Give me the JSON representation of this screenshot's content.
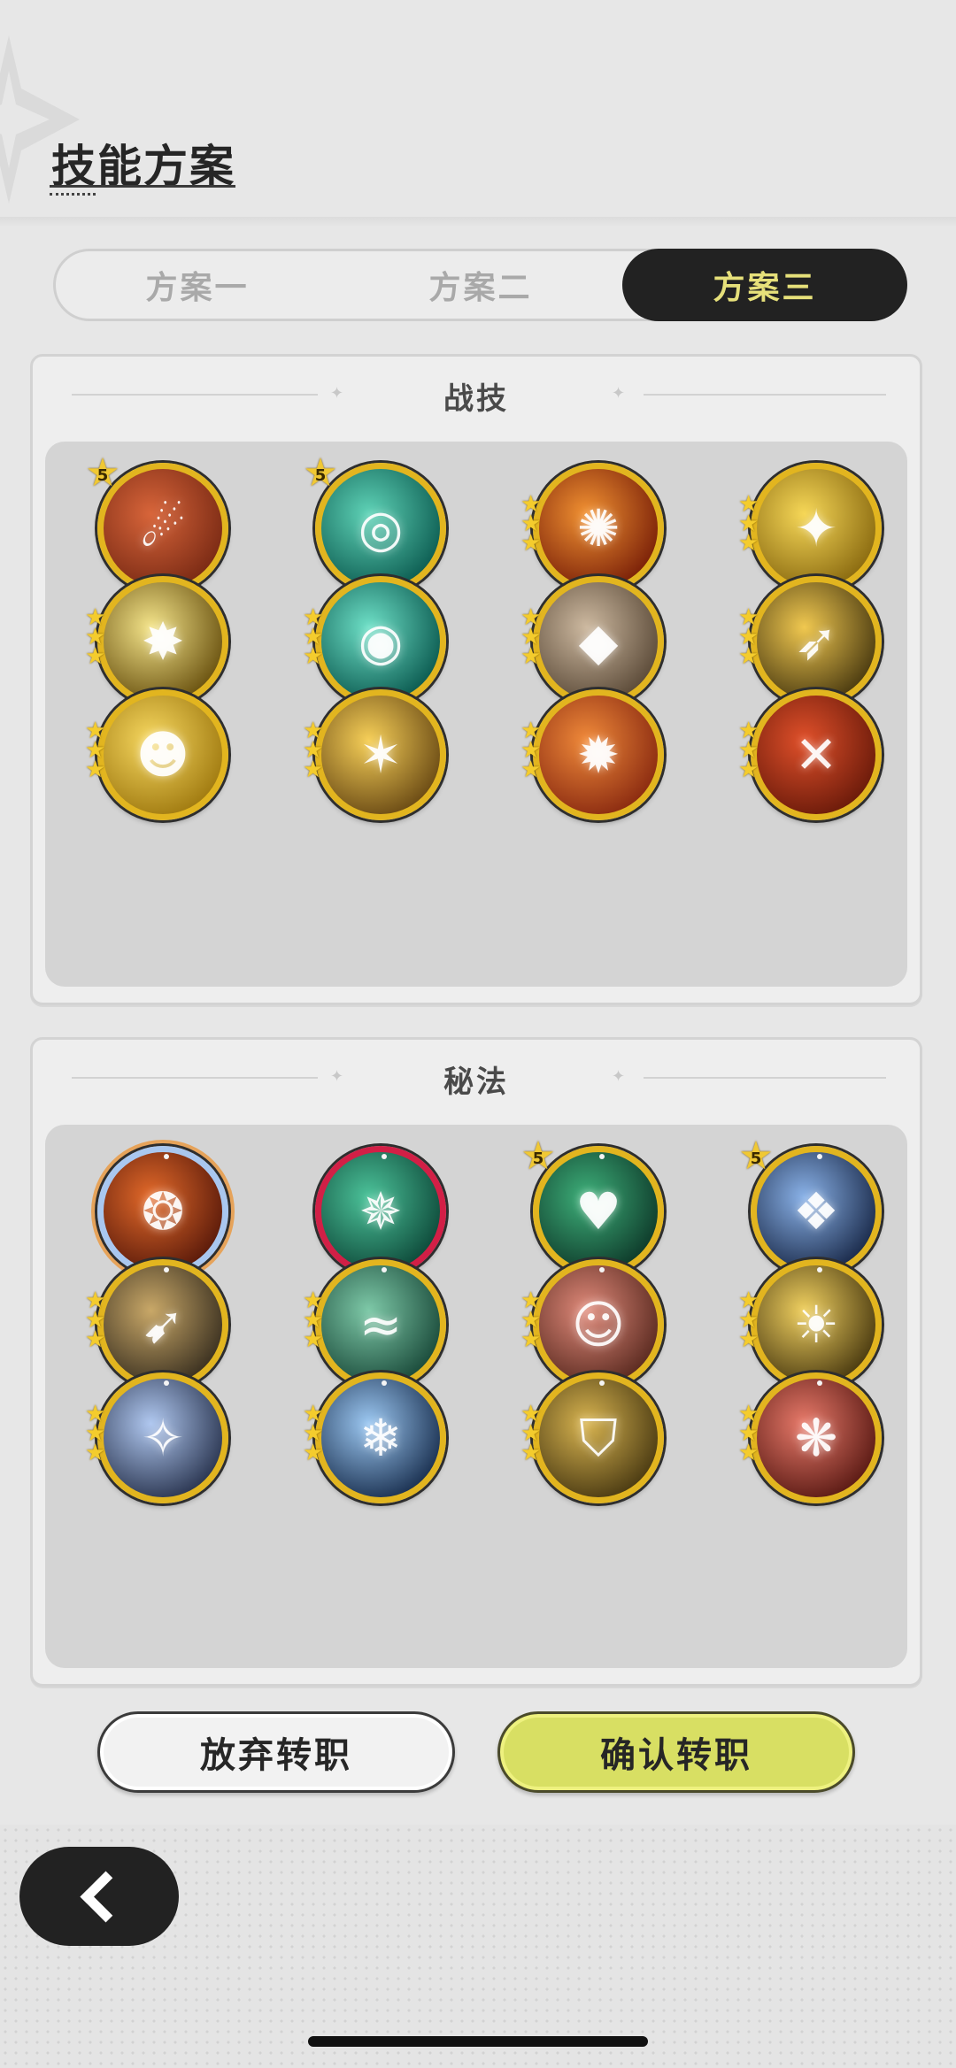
{
  "header": {
    "title": "技能方案"
  },
  "tabs": [
    {
      "label": "方案一",
      "active": false
    },
    {
      "label": "方案二",
      "active": false
    },
    {
      "label": "方案三",
      "active": true
    }
  ],
  "sections": [
    {
      "title": "战技",
      "icons": [
        {
          "name": "meteor-skill-icon",
          "badge": "5",
          "colors": [
            "#7a2a14",
            "#d8653a"
          ],
          "glyph": "☄"
        },
        {
          "name": "wind-slash-skill-icon",
          "badge": "5",
          "colors": [
            "#0d5d52",
            "#5fd3b7"
          ],
          "glyph": "◎"
        },
        {
          "name": "flame-burst-skill-icon",
          "stars": 3,
          "colors": [
            "#7a2008",
            "#f29232"
          ],
          "glyph": "✺"
        },
        {
          "name": "star-strike-skill-icon",
          "stars": 3,
          "colors": [
            "#8a6a10",
            "#f6d757"
          ],
          "glyph": "✦"
        },
        {
          "name": "lightning-orb-skill-icon",
          "stars": 3,
          "colors": [
            "#6a5210",
            "#f4e48a"
          ],
          "glyph": "✸"
        },
        {
          "name": "whirlwind-skill-icon",
          "stars": 3,
          "colors": [
            "#0b5a50",
            "#6ee0c7"
          ],
          "glyph": "◉"
        },
        {
          "name": "rock-shield-skill-icon",
          "stars": 3,
          "colors": [
            "#5b4a38",
            "#cdb9a0"
          ],
          "glyph": "◆"
        },
        {
          "name": "light-dash-skill-icon",
          "stars": 3,
          "colors": [
            "#4a3a10",
            "#f0c850"
          ],
          "glyph": "➶"
        },
        {
          "name": "guardian-figure-skill-icon",
          "stars": 3,
          "colors": [
            "#a07a10",
            "#f7d860"
          ],
          "glyph": "☻"
        },
        {
          "name": "shatter-skill-icon",
          "stars": 3,
          "colors": [
            "#6a4a14",
            "#f6cf58"
          ],
          "glyph": "✶"
        },
        {
          "name": "fire-spiral-skill-icon",
          "stars": 3,
          "colors": [
            "#8a2a10",
            "#f08a3a"
          ],
          "glyph": "✹"
        },
        {
          "name": "thorn-blast-skill-icon",
          "stars": 3,
          "colors": [
            "#6a1a0a",
            "#e0502a"
          ],
          "glyph": "✕"
        }
      ]
    },
    {
      "title": "秘法",
      "icons": [
        {
          "name": "fire-core-secret-icon",
          "frame": "rainbow",
          "colors": [
            "#5a1a0a",
            "#e46a2a"
          ],
          "glyph": "❂"
        },
        {
          "name": "emerald-spikes-secret-icon",
          "frame": "red",
          "colors": [
            "#0e4a3a",
            "#4cc39a"
          ],
          "glyph": "✵"
        },
        {
          "name": "heart-heal-secret-icon",
          "badge": "5",
          "colors": [
            "#0e3a2a",
            "#3eb07a"
          ],
          "glyph": "♥"
        },
        {
          "name": "crystal-shard-secret-icon",
          "badge": "5",
          "colors": [
            "#1a2a4a",
            "#8ab2e8"
          ],
          "glyph": "❖"
        },
        {
          "name": "wing-hand-secret-icon",
          "stars": 3,
          "colors": [
            "#3a3020",
            "#c9a868"
          ],
          "glyph": "➹"
        },
        {
          "name": "wave-leap-secret-icon",
          "stars": 3,
          "colors": [
            "#1a4a3a",
            "#7ec9a8"
          ],
          "glyph": "≈"
        },
        {
          "name": "healer-figure-secret-icon",
          "stars": 3,
          "colors": [
            "#5a2a20",
            "#e08a7a"
          ],
          "glyph": "☺"
        },
        {
          "name": "radiant-figure-secret-icon",
          "stars": 3,
          "colors": [
            "#4a3a10",
            "#f0d060"
          ],
          "glyph": "☀"
        },
        {
          "name": "rising-star-secret-icon",
          "stars": 3,
          "colors": [
            "#2a3550",
            "#b0c8f0"
          ],
          "glyph": "✧"
        },
        {
          "name": "ice-crystal-secret-icon",
          "stars": 3,
          "colors": [
            "#1a3050",
            "#9cc8f2"
          ],
          "glyph": "❄"
        },
        {
          "name": "golden-shield-secret-icon",
          "stars": 3,
          "colors": [
            "#4a3a12",
            "#d8b450"
          ],
          "glyph": "⛉"
        },
        {
          "name": "flame-orb-secret-icon",
          "stars": 3,
          "colors": [
            "#5a1a14",
            "#e87a6a"
          ],
          "glyph": "❋"
        }
      ]
    }
  ],
  "buttons": {
    "abandon": "放弃转职",
    "confirm": "确认转职"
  }
}
